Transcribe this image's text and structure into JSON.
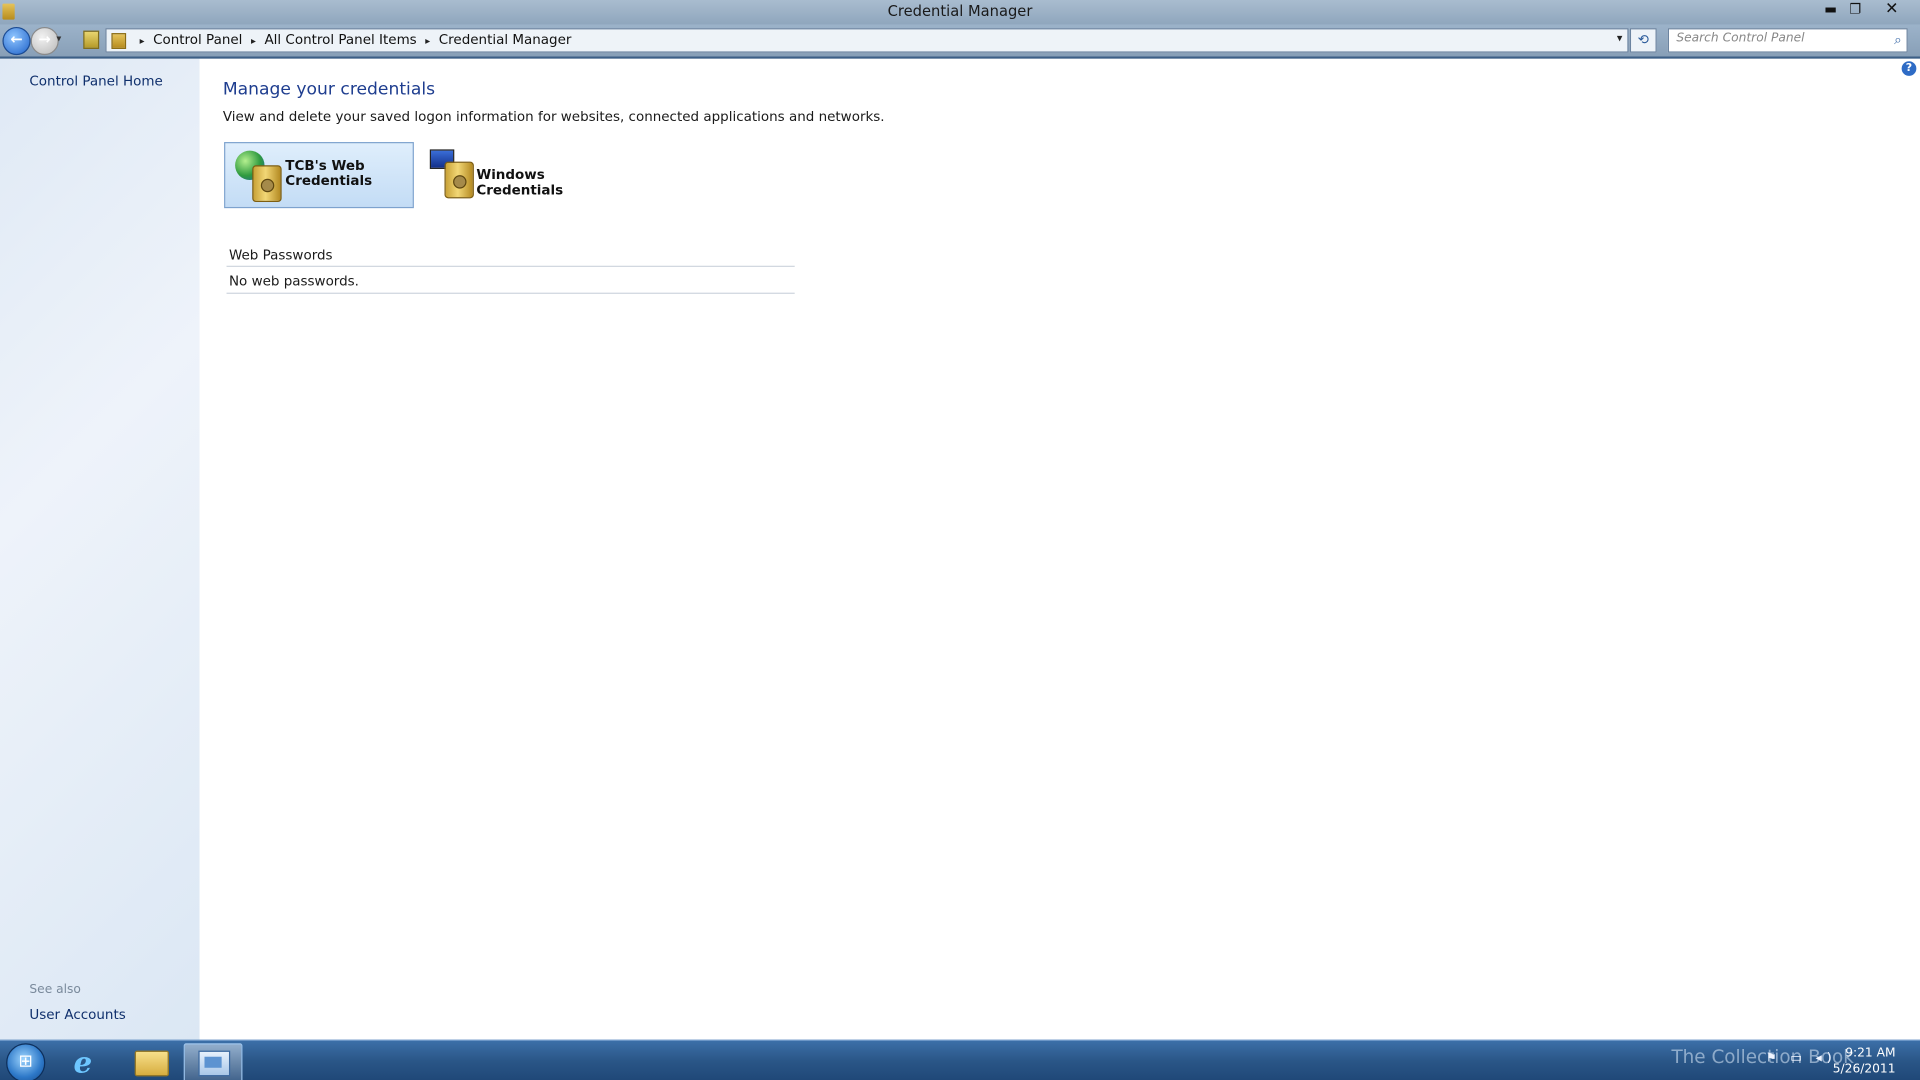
{
  "window": {
    "title": "Credential Manager",
    "buttons": {
      "minimize": "▬",
      "maximize": "❐",
      "close": "✕"
    }
  },
  "navbar": {
    "back_icon": "←",
    "forward_icon": "→",
    "recent_icon": "▾",
    "breadcrumb": [
      "Control Panel",
      "All Control Panel Items",
      "Credential Manager"
    ],
    "separator": "▸",
    "dropdown_icon": "▾",
    "refresh_icon": "⟲",
    "search_placeholder": "Search Control Panel",
    "search_icon": "⌕"
  },
  "left_pane": {
    "home_link": "Control Panel Home",
    "see_also_label": "See also",
    "see_also_links": [
      "User Accounts"
    ]
  },
  "main": {
    "help_icon": "?",
    "heading": "Manage your credentials",
    "description": "View and delete your saved logon information for websites, connected applications and networks.",
    "credential_types": [
      {
        "label_line1": "TCB's Web",
        "label_line2": "Credentials",
        "selected": true,
        "icon": "globe-vault-icon"
      },
      {
        "label": "Windows Credentials",
        "selected": false,
        "icon": "monitor-vault-icon"
      }
    ],
    "section_title": "Web Passwords",
    "empty_message": "No web passwords."
  },
  "taskbar": {
    "start_icon": "⊞",
    "pinned": [
      "internet-explorer-icon",
      "file-explorer-icon",
      "control-panel-icon"
    ],
    "ie_glyph": "e",
    "watermark": "The Collection Book",
    "tray_icons": "⚑ ▭ ◂)",
    "time": "9:21 AM",
    "date": "5/26/2011"
  }
}
